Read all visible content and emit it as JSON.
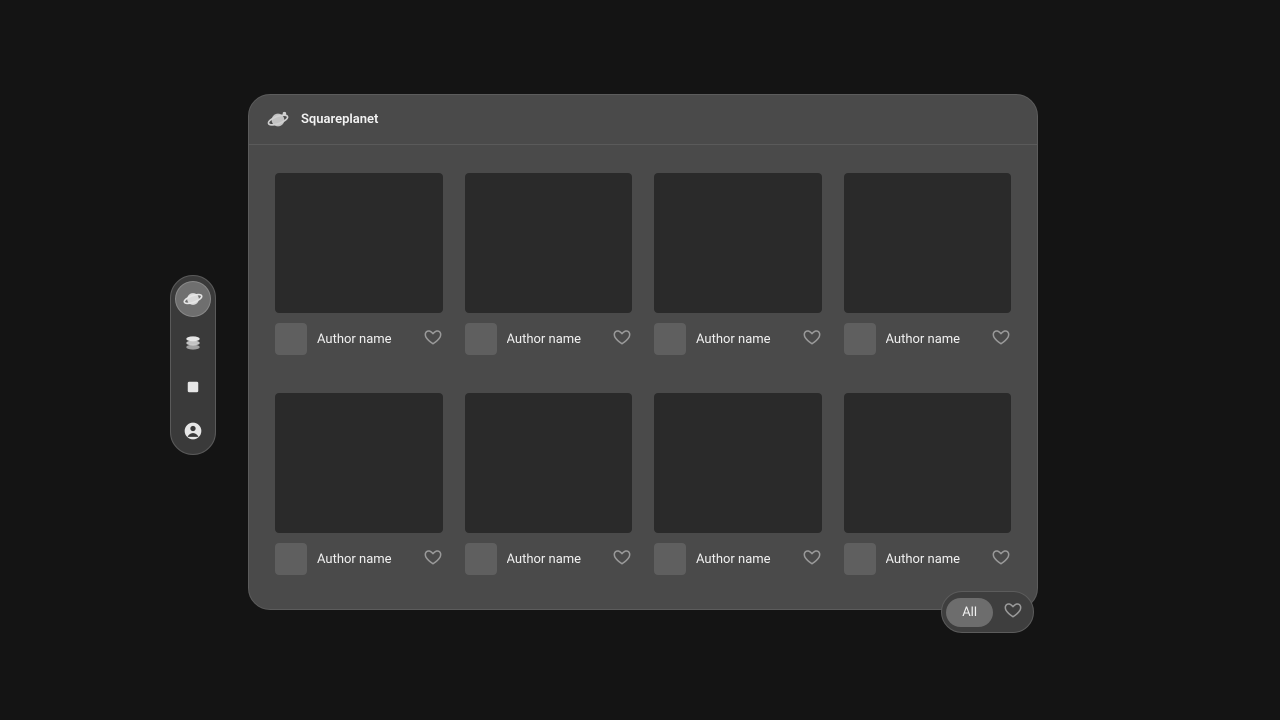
{
  "header": {
    "title": "Squareplanet"
  },
  "filter": {
    "all_label": "All"
  },
  "cards": [
    {
      "author": "Author name"
    },
    {
      "author": "Author name"
    },
    {
      "author": "Author name"
    },
    {
      "author": "Author name"
    },
    {
      "author": "Author name"
    },
    {
      "author": "Author name"
    },
    {
      "author": "Author name"
    },
    {
      "author": "Author name"
    }
  ]
}
